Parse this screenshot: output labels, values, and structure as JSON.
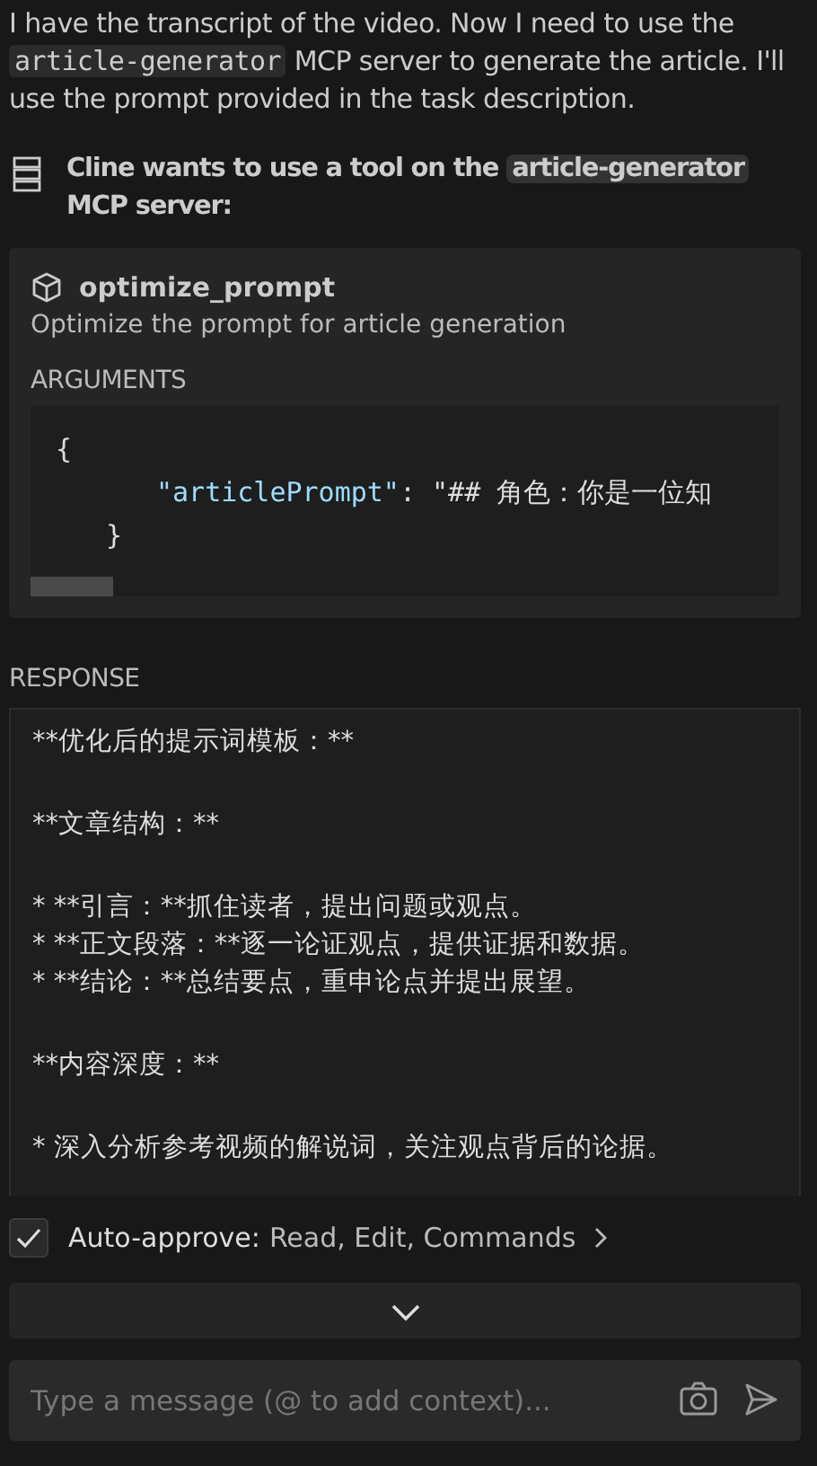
{
  "message": {
    "parts": [
      {
        "kind": "text",
        "text": "I have the transcript of the video. Now I need to use the "
      },
      {
        "kind": "code",
        "text": "article-generator"
      },
      {
        "kind": "text",
        "text": " MCP server to generate the article. I'll use the prompt provided in the task description."
      }
    ]
  },
  "tool_request": {
    "parts": [
      {
        "kind": "text",
        "text": "Cline wants to use a tool on the "
      },
      {
        "kind": "code",
        "text": "article-generator"
      },
      {
        "kind": "text",
        "text": " MCP server:"
      }
    ]
  },
  "tool": {
    "name": "optimize_prompt",
    "description": "Optimize the prompt for article generation",
    "arguments_label": "ARGUMENTS",
    "arguments_lines": [
      {
        "kind": "open",
        "text": "{"
      },
      {
        "kind": "entry",
        "key": "\"articlePrompt\"",
        "text": ": \"## 角色：你是一位知"
      },
      {
        "kind": "close",
        "text": "}"
      }
    ]
  },
  "response": {
    "label": "RESPONSE",
    "groups": [
      [
        "**优化后的提示词模板：**"
      ],
      [
        "**文章结构：**"
      ],
      [
        "*  **引言：**抓住读者，提出问题或观点。",
        "*  **正文段落：**逐一论证观点，提供证据和数据。",
        "*  **结论：**总结要点，重申论点并提出展望。"
      ],
      [
        "**内容深度：**"
      ],
      [
        "*  深入分析参考视频的解说词，关注观点背后的论据。"
      ]
    ]
  },
  "auto_approve": {
    "checked": true,
    "label": "Auto-approve:",
    "value": "Read, Edit, Commands"
  },
  "input": {
    "placeholder": "Type a message (@ to add context)..."
  }
}
